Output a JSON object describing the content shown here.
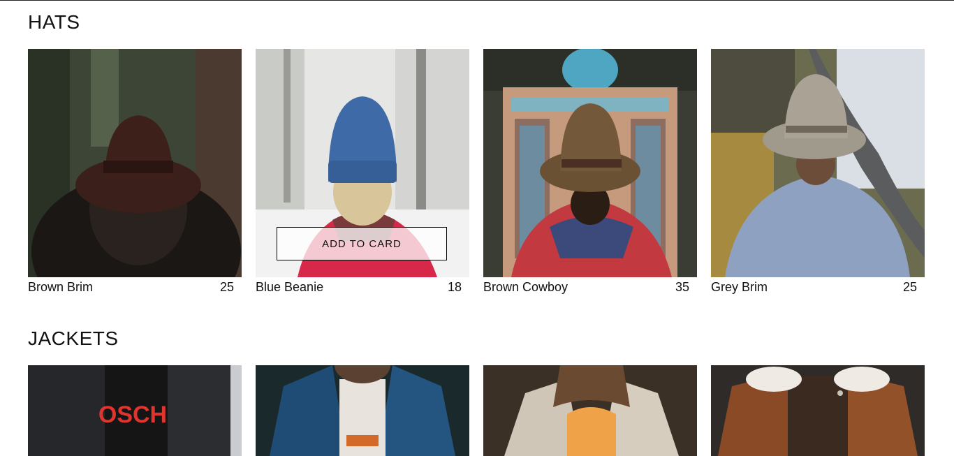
{
  "sections": [
    {
      "title": "HATS",
      "items": [
        {
          "name": "Brown Brim",
          "price": "25",
          "image": "woman-brown-fedora-forest"
        },
        {
          "name": "Blue Beanie",
          "price": "18",
          "image": "woman-blue-beanie-snow"
        },
        {
          "name": "Brown Cowboy",
          "price": "35",
          "image": "man-brown-cowboy-hat-mosque"
        },
        {
          "name": "Grey Brim",
          "price": "25",
          "image": "man-grey-brim-hat-coast"
        }
      ],
      "hover_button_label": "ADD TO CARD"
    },
    {
      "title": "JACKETS",
      "items": [
        {
          "image": "black-denim-jacket"
        },
        {
          "image": "blue-denim-jacket"
        },
        {
          "image": "light-denim-jacket-woman"
        },
        {
          "image": "brown-suede-shearling-jacket"
        }
      ]
    }
  ]
}
